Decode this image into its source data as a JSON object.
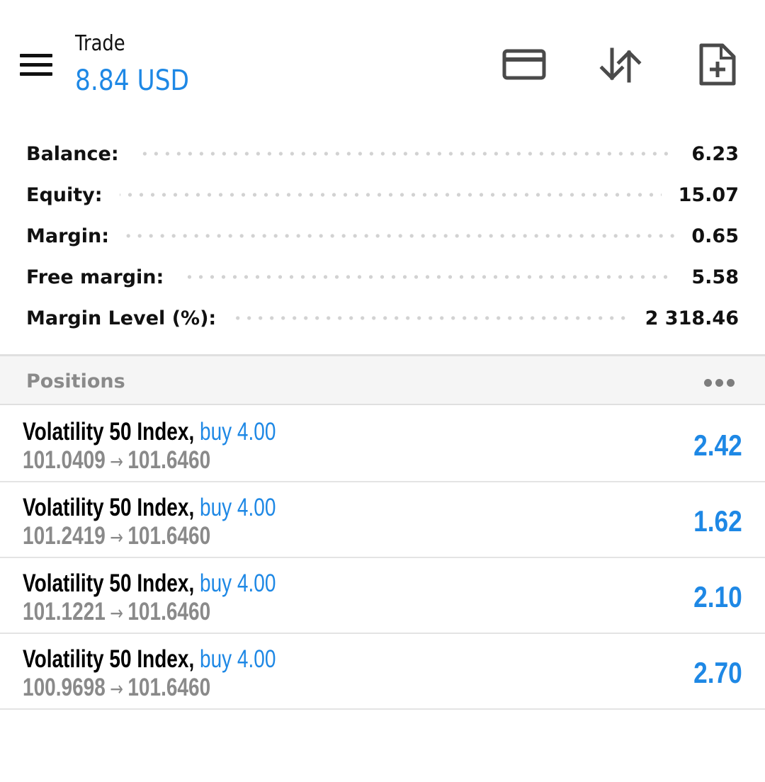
{
  "header": {
    "title": "Trade",
    "subtitle": "8.84 USD",
    "icons": {
      "menu": "menu-icon",
      "deposit": "credit-card-icon",
      "sort": "sort-icon",
      "new_order": "new-order-icon"
    }
  },
  "summary": [
    {
      "label": "Balance:",
      "value": "6.23"
    },
    {
      "label": "Equity:",
      "value": "15.07"
    },
    {
      "label": "Margin:",
      "value": "0.65"
    },
    {
      "label": "Free margin:",
      "value": "5.58"
    },
    {
      "label": "Margin Level (%):",
      "value": "2 318.46"
    }
  ],
  "positions": {
    "title": "Positions",
    "items": [
      {
        "symbol": "Volatility 50 Index,",
        "direction": "buy 4.00",
        "open": "101.0409",
        "arrow": "→",
        "current": "101.6460",
        "profit": "2.42"
      },
      {
        "symbol": "Volatility 50 Index,",
        "direction": "buy 4.00",
        "open": "101.2419",
        "arrow": "→",
        "current": "101.6460",
        "profit": "1.62"
      },
      {
        "symbol": "Volatility 50 Index,",
        "direction": "buy 4.00",
        "open": "101.1221",
        "arrow": "→",
        "current": "101.6460",
        "profit": "2.10"
      },
      {
        "symbol": "Volatility 50 Index,",
        "direction": "buy 4.00",
        "open": "100.9698",
        "arrow": "→",
        "current": "101.6460",
        "profit": "2.70"
      }
    ]
  },
  "colors": {
    "accent": "#1e88e5",
    "muted": "#8a8a8a",
    "icon": "#4a4a4a"
  }
}
